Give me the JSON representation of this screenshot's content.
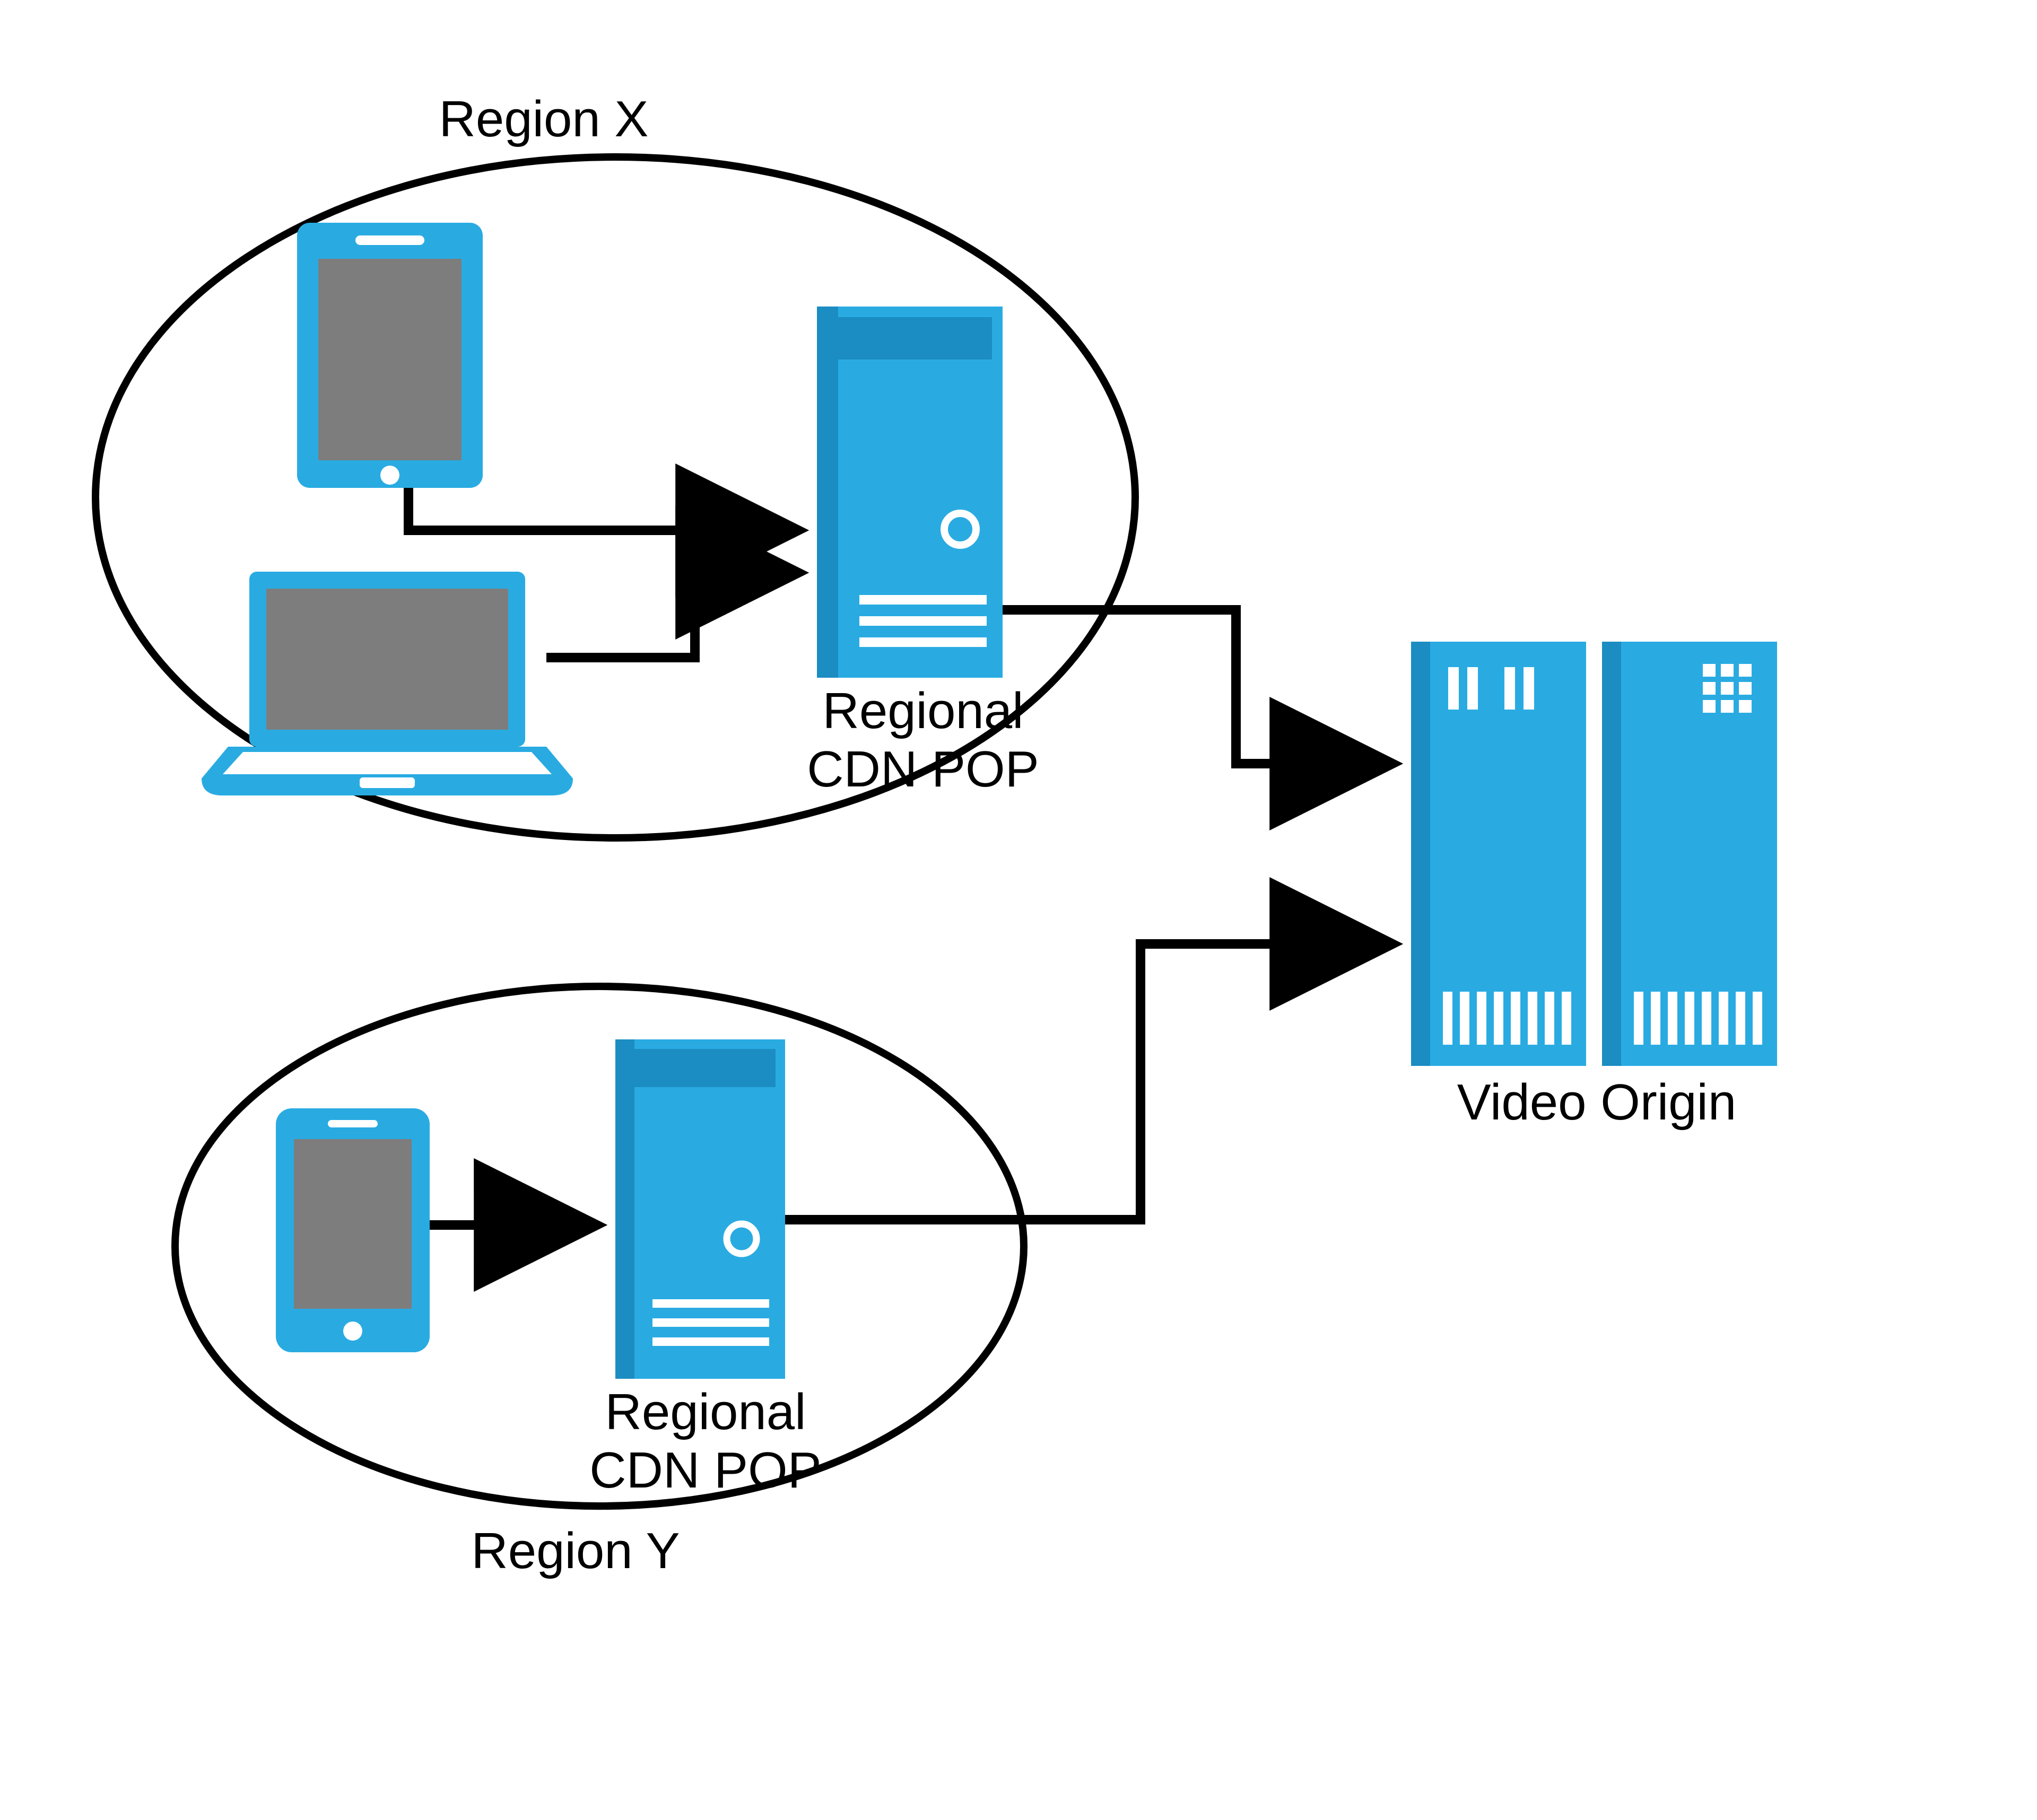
{
  "colors": {
    "brand": "#29abe2",
    "brand_dark": "#1b8dc2",
    "screen": "#7d7d7d",
    "stroke": "#000000",
    "bg": "#ffffff"
  },
  "regionX": {
    "title": "Region X",
    "cdn_label": "Regional\nCDN POP"
  },
  "regionY": {
    "title": "Region Y",
    "cdn_label": "Regional\nCDN POP"
  },
  "origin": {
    "label": "Video Origin"
  }
}
